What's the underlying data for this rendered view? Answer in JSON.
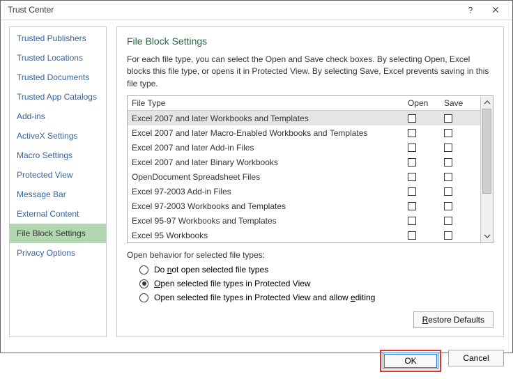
{
  "window": {
    "title": "Trust Center"
  },
  "sidebar": {
    "items": [
      {
        "label": "Trusted Publishers",
        "selected": false
      },
      {
        "label": "Trusted Locations",
        "selected": false
      },
      {
        "label": "Trusted Documents",
        "selected": false
      },
      {
        "label": "Trusted App Catalogs",
        "selected": false
      },
      {
        "label": "Add-ins",
        "selected": false
      },
      {
        "label": "ActiveX Settings",
        "selected": false
      },
      {
        "label": "Macro Settings",
        "selected": false
      },
      {
        "label": "Protected View",
        "selected": false
      },
      {
        "label": "Message Bar",
        "selected": false
      },
      {
        "label": "External Content",
        "selected": false
      },
      {
        "label": "File Block Settings",
        "selected": true
      },
      {
        "label": "Privacy Options",
        "selected": false
      }
    ]
  },
  "main": {
    "section_title": "File Block Settings",
    "description": "For each file type, you can select the Open and Save check boxes. By selecting Open, Excel blocks this file type, or opens it in Protected View. By selecting Save, Excel prevents saving in this file type.",
    "columns": {
      "file_type": "File Type",
      "open": "Open",
      "save": "Save"
    },
    "rows": [
      {
        "label": "Excel 2007 and later Workbooks and Templates",
        "open": false,
        "save": false,
        "selected": true
      },
      {
        "label": "Excel 2007 and later Macro-Enabled Workbooks and Templates",
        "open": false,
        "save": false
      },
      {
        "label": "Excel 2007 and later Add-in Files",
        "open": false,
        "save": false
      },
      {
        "label": "Excel 2007 and later Binary Workbooks",
        "open": false,
        "save": false
      },
      {
        "label": "OpenDocument Spreadsheet Files",
        "open": false,
        "save": false
      },
      {
        "label": "Excel 97-2003 Add-in Files",
        "open": false,
        "save": false
      },
      {
        "label": "Excel 97-2003 Workbooks and Templates",
        "open": false,
        "save": false
      },
      {
        "label": "Excel 95-97 Workbooks and Templates",
        "open": false,
        "save": false
      },
      {
        "label": "Excel 95 Workbooks",
        "open": false,
        "save": false
      }
    ],
    "behavior": {
      "title": "Open behavior for selected file types:",
      "options": [
        {
          "label_pre": "Do ",
          "ul": "n",
          "label_post": "ot open selected file types",
          "checked": false
        },
        {
          "label_pre": "",
          "ul": "O",
          "label_post": "pen selected file types in Protected View",
          "checked": true
        },
        {
          "label_pre": "Open selected file types in Protected View and allow ",
          "ul": "e",
          "label_post": "diting",
          "checked": false
        }
      ]
    },
    "restore_label_pre": "",
    "restore_ul": "R",
    "restore_label_post": "estore Defaults"
  },
  "footer": {
    "ok": "OK",
    "cancel": "Cancel"
  }
}
